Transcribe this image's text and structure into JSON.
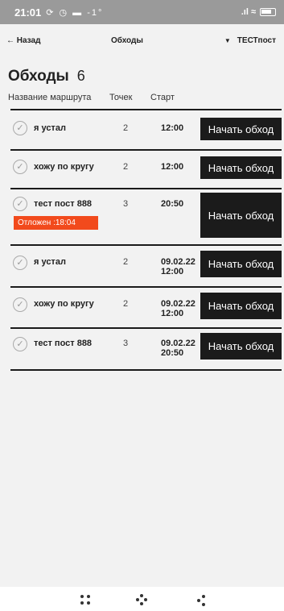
{
  "status_bar": {
    "time": "21:01",
    "left_icons": "⟳ ◷ ▬ -1°",
    "right_icons": ".ıl ≈"
  },
  "nav": {
    "back_label": "← Назад",
    "title": "Обходы",
    "post_label": "ТЕСТпост",
    "post_dropdown_icon": "▼"
  },
  "heading": {
    "title": "Обходы",
    "count": "6"
  },
  "columns": {
    "name": "Название маршрута",
    "points": "Точек",
    "start": "Старт"
  },
  "rows": [
    {
      "name": "я устал",
      "points": "2",
      "start": "12:00",
      "button": "Начать обход"
    },
    {
      "name": "хожу по кругу",
      "points": "2",
      "start": "12:00",
      "button": "Начать обход"
    },
    {
      "name": "тест пост 888",
      "points": "3",
      "start": "20:50",
      "button": "Начать обход",
      "badge": "Отложен :18:04"
    },
    {
      "name": "я устал",
      "points": "2",
      "start": "09.02.22\n12:00",
      "button": "Начать обход"
    },
    {
      "name": "хожу по кругу",
      "points": "2",
      "start": "09.02.22\n12:00",
      "button": "Начать обход"
    },
    {
      "name": "тест пост 888",
      "points": "3",
      "start": "09.02.22\n20:50",
      "button": "Начать обход"
    }
  ],
  "icons": {
    "check": "check-circle-icon",
    "nav_buttons": [
      "recents-icon",
      "home-icon",
      "back-icon"
    ]
  },
  "colors": {
    "status_bar": "#9a9a9a",
    "button_bg": "#1b1b1b",
    "badge_bg": "#f24a1c",
    "page_bg": "#f2f2f2"
  }
}
